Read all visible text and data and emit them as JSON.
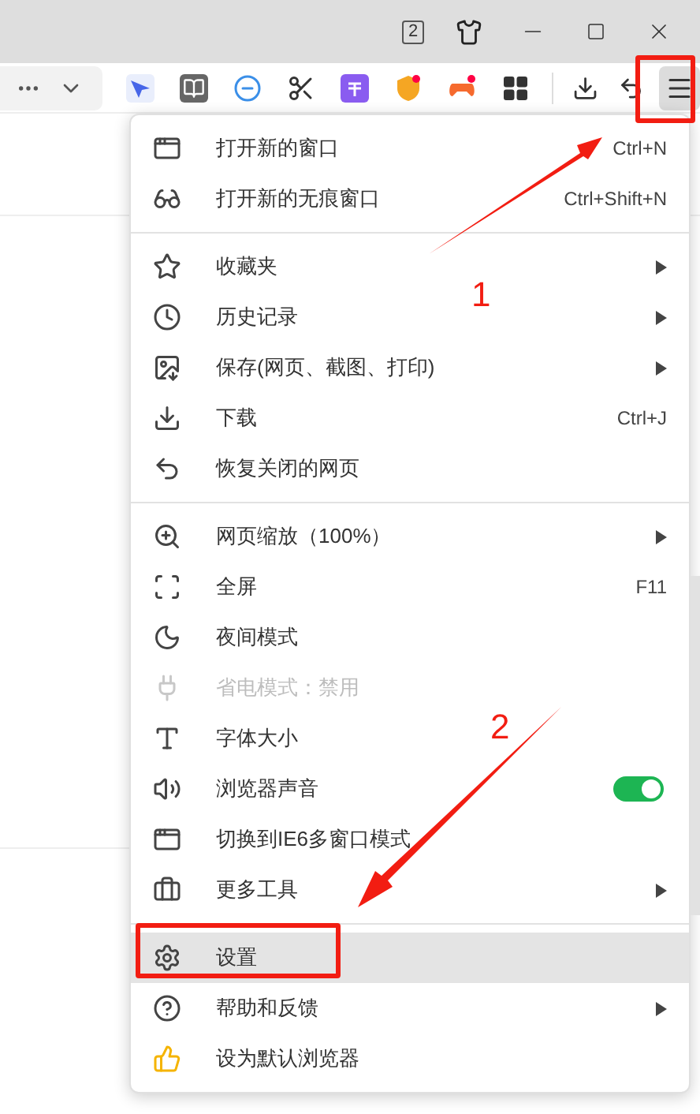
{
  "title_bar": {
    "tab_count": "2"
  },
  "menu": {
    "items": [
      {
        "kind": "item",
        "label": "打开新的窗口",
        "shortcut": "Ctrl+N",
        "submenu": false,
        "disabled": false,
        "selected": false
      },
      {
        "kind": "item",
        "label": "打开新的无痕窗口",
        "shortcut": "Ctrl+Shift+N",
        "submenu": false,
        "disabled": false,
        "selected": false
      },
      {
        "kind": "separator"
      },
      {
        "kind": "item",
        "label": "收藏夹",
        "submenu": true,
        "disabled": false,
        "selected": false
      },
      {
        "kind": "item",
        "label": "历史记录",
        "submenu": true,
        "disabled": false,
        "selected": false
      },
      {
        "kind": "item",
        "label": "保存(网页、截图、打印)",
        "submenu": true,
        "disabled": false,
        "selected": false
      },
      {
        "kind": "item",
        "label": "下载",
        "shortcut": "Ctrl+J",
        "submenu": false,
        "disabled": false,
        "selected": false
      },
      {
        "kind": "item",
        "label": "恢复关闭的网页",
        "submenu": false,
        "disabled": false,
        "selected": false
      },
      {
        "kind": "separator"
      },
      {
        "kind": "item",
        "label": "网页缩放（100%）",
        "submenu": true,
        "disabled": false,
        "selected": false
      },
      {
        "kind": "item",
        "label": "全屏",
        "shortcut": "F11",
        "submenu": false,
        "disabled": false,
        "selected": false
      },
      {
        "kind": "item",
        "label": "夜间模式",
        "submenu": false,
        "disabled": false,
        "selected": false
      },
      {
        "kind": "item",
        "label": "省电模式：禁用",
        "submenu": false,
        "disabled": true,
        "selected": false
      },
      {
        "kind": "item",
        "label": "字体大小",
        "submenu": false,
        "disabled": false,
        "selected": false
      },
      {
        "kind": "toggle",
        "label": "浏览器声音",
        "on": true
      },
      {
        "kind": "item",
        "label": "切换到IE6多窗口模式",
        "submenu": false,
        "disabled": false,
        "selected": false
      },
      {
        "kind": "item",
        "label": "更多工具",
        "submenu": true,
        "disabled": false,
        "selected": false
      },
      {
        "kind": "separator"
      },
      {
        "kind": "item",
        "label": "设置",
        "submenu": false,
        "disabled": false,
        "selected": true
      },
      {
        "kind": "item",
        "label": "帮助和反馈",
        "submenu": true,
        "disabled": false,
        "selected": false
      },
      {
        "kind": "item",
        "label": "设为默认浏览器",
        "submenu": false,
        "disabled": false,
        "selected": false
      }
    ]
  },
  "annotations": [
    {
      "label": "1"
    },
    {
      "label": "2"
    }
  ]
}
